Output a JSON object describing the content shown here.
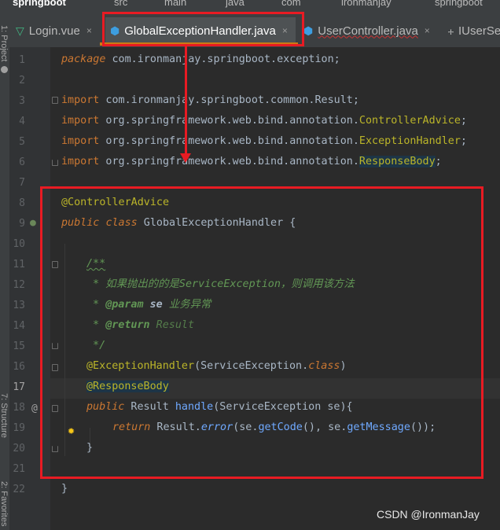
{
  "breadcrumb": [
    "springboot",
    "src",
    "main",
    "java",
    "com",
    "ironmanjay",
    "springboot"
  ],
  "side_panels": {
    "project": "1: Project",
    "structure": "7: Structure",
    "favorites": "2: Favorites"
  },
  "tabs": [
    {
      "label": "Login.vue",
      "icon": "vue-icon",
      "active": false
    },
    {
      "label": "GlobalExceptionHandler.java",
      "icon": "java-class-icon",
      "active": true
    },
    {
      "label": "UserController.java",
      "icon": "java-class-icon",
      "active": false
    },
    {
      "label": "IUserSe",
      "icon": "interface-icon",
      "active": false
    }
  ],
  "close_glyph": "×",
  "line_numbers": [
    "1",
    "2",
    "3",
    "4",
    "5",
    "6",
    "7",
    "8",
    "9",
    "10",
    "11",
    "12",
    "13",
    "14",
    "15",
    "16",
    "17",
    "18",
    "19",
    "20",
    "21",
    "22"
  ],
  "current_line": "17",
  "code": {
    "l1_kw": "package",
    "l1_rest": " com.ironmanjay.springboot.exception;",
    "l3_kw": "import",
    "l3_rest": " com.ironmanjay.springboot.common.Result;",
    "l4_kw": "import",
    "l4_pre": " org.springframework.web.bind.annotation.",
    "l4_cls": "ControllerAdvice",
    "l4_end": ";",
    "l5_kw": "import",
    "l5_pre": " org.springframework.web.bind.annotation.",
    "l5_cls": "ExceptionHandler",
    "l5_end": ";",
    "l6_kw": "import",
    "l6_pre": " org.springframework.web.bind.annotation.",
    "l6_cls": "ResponseBody",
    "l6_end": ";",
    "l8_ann": "@ControllerAdvice",
    "l9_kw1": "public",
    "l9_kw2": "class",
    "l9_rest": " GlobalExceptionHandler {",
    "l11_doc": "/**",
    "l12_doc": " * 如果抛出的的是ServiceException，则调用该方法",
    "l13_star": " * ",
    "l13_tag": "@param",
    "l13_param": " se",
    "l13_text": " 业务异常",
    "l14_star": " * ",
    "l14_tag": "@return",
    "l14_ref": " Result",
    "l15_doc": " */",
    "l16_ann": "@ExceptionHandler",
    "l16_open": "(ServiceException.",
    "l16_kw": "class",
    "l16_close": ")",
    "l17_ann": "@ResponseBody",
    "l18_kw": "public",
    "l18_type": " Result ",
    "l18_fn": "handle",
    "l18_rest": "(ServiceException se){",
    "l19_kw": "return",
    "l19_pre": " Result.",
    "l19_meth": "error",
    "l19_mid": "(se.",
    "l19_get1": "getCode",
    "l19_mid2": "(), se.",
    "l19_get2": "getMessage",
    "l19_end": "());",
    "l20": "}",
    "l22": "}"
  },
  "gutter_icons": {
    "line9": "spring-bean-icon",
    "line18": "override-at-icon",
    "line19": "lightbulb-icon"
  },
  "colors": {
    "keyword": "#cc7832",
    "annotation": "#bbb529",
    "method_decl": "#ffc66d",
    "static_method": "#9876aa",
    "javadoc": "#629755",
    "annotation_box": "#e81b23",
    "active_tab_bar": "#cc7a14"
  },
  "watermark": "CSDN @IronmanJay"
}
